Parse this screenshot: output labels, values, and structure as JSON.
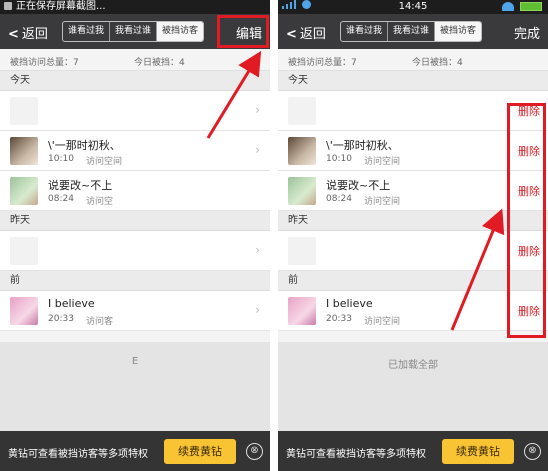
{
  "left": {
    "status": {
      "text": "正在保存屏幕截图..."
    },
    "nav": {
      "back": "返回",
      "tabs": [
        "谁看过我",
        "我看过谁",
        "被挡访客"
      ],
      "right": "编辑"
    },
    "stats": {
      "total": "被挡访问总量：7",
      "today": "今日被挡：4"
    },
    "sections": {
      "today": "今天",
      "yesterday": "昨天",
      "earlier": "前"
    },
    "rows": [
      {
        "name": "",
        "time": "",
        "action": ""
      },
      {
        "name": "\\'一那时初秋、",
        "time": "10:10",
        "action": "访问空间"
      },
      {
        "name": "说要改~不上",
        "time": "08:24",
        "action": "访问空"
      },
      {
        "name": "",
        "time": "",
        "action": ""
      },
      {
        "name": "I  believe",
        "time": "20:33",
        "action": "访问客"
      }
    ],
    "footer": "E",
    "banner": {
      "text": "黄钻可查看被挡访客等多项特权",
      "button": "续费黄钻",
      "close": "⊗"
    }
  },
  "right": {
    "status": {
      "time": "14:45"
    },
    "nav": {
      "back": "返回",
      "tabs": [
        "谁看过我",
        "我看过谁",
        "被挡访客"
      ],
      "right": "完成"
    },
    "stats": {
      "total": "被挡访问总量：7",
      "today": "今日被挡：4"
    },
    "sections": {
      "today": "今天",
      "yesterday": "昨天",
      "earlier": "前"
    },
    "rows": [
      {
        "name": "",
        "time": "",
        "action": "",
        "delete": "删除"
      },
      {
        "name": "\\'一那时初秋、",
        "time": "10:10",
        "action": "访问空间",
        "delete": "删除"
      },
      {
        "name": "说要改~不上",
        "time": "08:24",
        "action": "访问空间",
        "delete": "删除"
      },
      {
        "name": "",
        "time": "",
        "action": "",
        "delete": "删除"
      },
      {
        "name": "I  believe",
        "time": "20:33",
        "action": "访问空间",
        "delete": "删除"
      }
    ],
    "footer": "已加载全部",
    "banner": {
      "text": "黄钻可查看被挡访客等多项特权",
      "button": "续费黄钻",
      "close": "⊗"
    }
  },
  "colors": {
    "annotation_red": "#e11b24",
    "delete_red": "#d41b22",
    "navbar": "#3a3a3c",
    "vip_gold": "#f9c433"
  }
}
